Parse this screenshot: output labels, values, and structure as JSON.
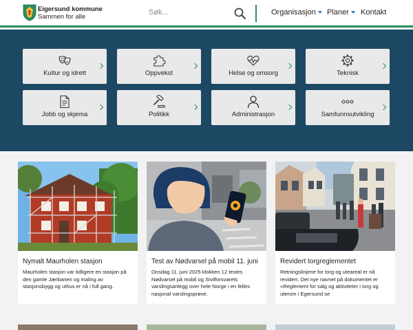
{
  "header": {
    "brand_name": "Eigersund kommune",
    "brand_tagline": "Sammen for alle",
    "search_placeholder": "Søk...",
    "nav": [
      {
        "label": "Organisasjon",
        "has_dropdown": true
      },
      {
        "label": "Planer",
        "has_dropdown": true
      },
      {
        "label": "Kontakt",
        "has_dropdown": false
      }
    ],
    "accent_color": "#2a8f5f",
    "link_color": "#2a74b9"
  },
  "quick_links": {
    "background_color": "#1c4864",
    "items": [
      {
        "label": "Kultur og idrett",
        "icon": "theater-masks-icon"
      },
      {
        "label": "Oppvekst",
        "icon": "puzzle-piece-icon"
      },
      {
        "label": "Helse og omsorg",
        "icon": "heart-pulse-icon"
      },
      {
        "label": "Teknisk",
        "icon": "gear-icon"
      },
      {
        "label": "Jobb og skjema",
        "icon": "document-icon"
      },
      {
        "label": "Politikk",
        "icon": "gavel-icon"
      },
      {
        "label": "Administrasjon",
        "icon": "person-icon"
      },
      {
        "label": "Samfunnsutvikling",
        "icon": "dots-icon"
      }
    ]
  },
  "news": [
    {
      "title": "Nymalt Maurholen stasjon",
      "body": "Maurholen stasjon var tidligere en stasjon på den gamle Jærbanen og maling av stasjonsbygg og uthus er nå i full gang.",
      "image": "red-wooden-station-with-scaffolding"
    },
    {
      "title": "Test av Nødvarsel på mobil 11. juni",
      "body": "Onsdag 11. juni 2025 klokken 12 testes Nødvarsel på mobil og Sivilforsvarets varslingsanlegg over hele Norge i en felles nasjonal varslingsprøve.",
      "image": "illustration-person-with-phone-alert"
    },
    {
      "title": "Revidert torgreglementet",
      "body": "Retningslinjene for torg og uteareal er nå revidert. Det nye navnet på dokumentet er «Reglement for salg og aktiviteter i torg og uterom i Egersund se",
      "image": "busy-pedestrian-street"
    }
  ]
}
